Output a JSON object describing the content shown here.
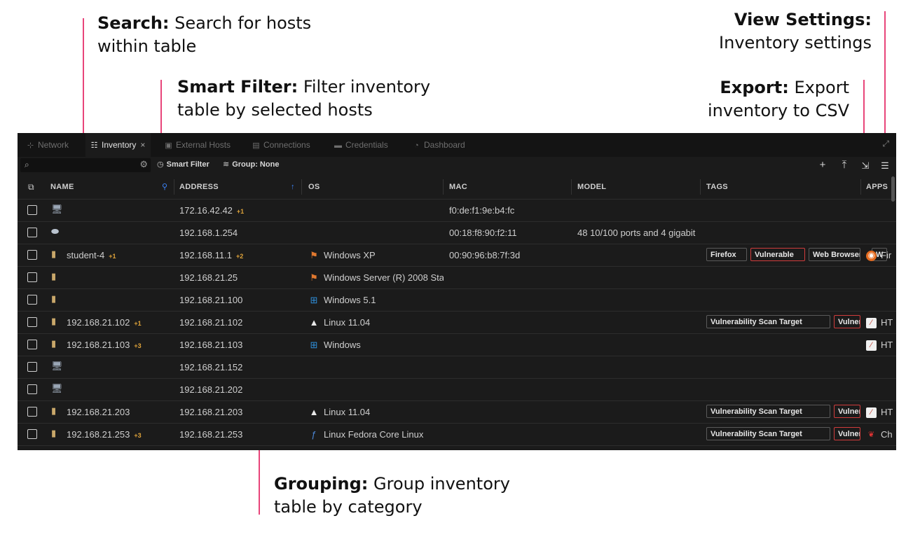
{
  "callouts": {
    "search": {
      "title": "Search:",
      "text1": "Search for hosts",
      "text2": "within table"
    },
    "smart_filter": {
      "title": "Smart Filter:",
      "text1": "Filter inventory",
      "text2": "table by selected hosts"
    },
    "view_settings": {
      "title": "View Settings:",
      "text1": "Inventory settings"
    },
    "export": {
      "title": "Export:",
      "text1": "Export",
      "text2": "inventory to CSV"
    },
    "grouping": {
      "title": "Grouping:",
      "text1": "Group inventory",
      "text2": "table by category"
    }
  },
  "tabs": [
    {
      "label": "Network",
      "icon": "network-icon"
    },
    {
      "label": "Inventory",
      "icon": "inventory-icon",
      "active": true
    },
    {
      "label": "External Hosts",
      "icon": "external-hosts-icon"
    },
    {
      "label": "Connections",
      "icon": "connections-icon"
    },
    {
      "label": "Credentials",
      "icon": "credentials-icon"
    },
    {
      "label": "Dashboard",
      "icon": "dashboard-icon"
    }
  ],
  "toolbar": {
    "search_value": "",
    "smart_filter_label": "Smart Filter",
    "group_label": "Group: None"
  },
  "columns": [
    "NAME",
    "ADDRESS",
    "OS",
    "MAC",
    "MODEL",
    "TAGS",
    "APPS"
  ],
  "colors": {
    "accent_line": "#e8457a",
    "extra_count": "#e0a43a",
    "vulnerable_border": "#d03c3c"
  },
  "rows": [
    {
      "device_icon": "workstation-icon",
      "name": "",
      "name_extra": "",
      "address": "172.16.42.42",
      "address_extra": "+1",
      "os": "",
      "os_icon": "",
      "mac": "f0:de:f1:9e:b4:fc",
      "model": "",
      "tags": [],
      "app": "",
      "app_icon": ""
    },
    {
      "device_icon": "router-icon",
      "name": "",
      "name_extra": "",
      "address": "192.168.1.254",
      "address_extra": "",
      "os": "",
      "os_icon": "",
      "mac": "00:18:f8:90:f2:11",
      "model": "48 10/100 ports and 4 gigabit",
      "tags": [],
      "app": "",
      "app_icon": ""
    },
    {
      "device_icon": "server-icon",
      "name": "student-4",
      "name_extra": "+1",
      "address": "192.168.11.1",
      "address_extra": "+2",
      "os": "Windows XP",
      "os_icon": "windows-xp-icon",
      "mac": "00:90:96:b8:7f:3d",
      "model": "",
      "tags": [
        "Firefox",
        "Vulnerable",
        "Web Browser",
        "W"
      ],
      "app": "Fir",
      "app_icon": "firefox-icon"
    },
    {
      "device_icon": "server-icon",
      "name": "",
      "name_extra": "",
      "address": "192.168.21.25",
      "address_extra": "",
      "os": "Windows Server (R) 2008 Sta",
      "os_icon": "windows-xp-icon",
      "mac": "",
      "model": "",
      "tags": [],
      "app": "",
      "app_icon": ""
    },
    {
      "device_icon": "server-icon",
      "name": "",
      "name_extra": "",
      "address": "192.168.21.100",
      "address_extra": "",
      "os": "Windows 5.1",
      "os_icon": "windows-icon",
      "mac": "",
      "model": "",
      "tags": [],
      "app": "",
      "app_icon": ""
    },
    {
      "device_icon": "server-icon",
      "name": "192.168.21.102",
      "name_extra": "+1",
      "address": "192.168.21.102",
      "address_extra": "",
      "os": "Linux 11.04",
      "os_icon": "linux-icon",
      "mac": "",
      "model": "",
      "tags": [
        "Vulnerability Scan Target",
        "Vulnerable"
      ],
      "app": "HT",
      "app_icon": "http-icon"
    },
    {
      "device_icon": "server-icon",
      "name": "192.168.21.103",
      "name_extra": "+3",
      "address": "192.168.21.103",
      "address_extra": "",
      "os": "Windows",
      "os_icon": "windows-icon",
      "mac": "",
      "model": "",
      "tags": [],
      "app": "HT",
      "app_icon": "http-icon"
    },
    {
      "device_icon": "workstation-icon",
      "name": "",
      "name_extra": "",
      "address": "192.168.21.152",
      "address_extra": "",
      "os": "",
      "os_icon": "",
      "mac": "",
      "model": "",
      "tags": [],
      "app": "",
      "app_icon": ""
    },
    {
      "device_icon": "workstation-icon",
      "name": "",
      "name_extra": "",
      "address": "192.168.21.202",
      "address_extra": "",
      "os": "",
      "os_icon": "",
      "mac": "",
      "model": "",
      "tags": [],
      "app": "",
      "app_icon": ""
    },
    {
      "device_icon": "server-icon",
      "name": "192.168.21.203",
      "name_extra": "",
      "address": "192.168.21.203",
      "address_extra": "",
      "os": "Linux 11.04",
      "os_icon": "linux-icon",
      "mac": "",
      "model": "",
      "tags": [
        "Vulnerability Scan Target",
        "Vulnerable"
      ],
      "app": "HT",
      "app_icon": "http-icon"
    },
    {
      "device_icon": "server-icon",
      "name": "192.168.21.253",
      "name_extra": "+3",
      "address": "192.168.21.253",
      "address_extra": "",
      "os": "Linux Fedora Core Linux",
      "os_icon": "fedora-icon",
      "mac": "",
      "model": "",
      "tags": [
        "Vulnerability Scan Target",
        "Vulnerable"
      ],
      "app": "Ch",
      "app_icon": "cherry-icon"
    }
  ]
}
